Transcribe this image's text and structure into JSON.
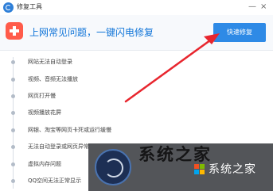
{
  "window": {
    "title": "修复工具",
    "min_glyph": "—",
    "close_glyph": "×"
  },
  "header": {
    "message": "上网常见问题，一键闪电修复",
    "fix_button_label": "快速修复"
  },
  "issues": [
    {
      "label": "网站无法自动登录"
    },
    {
      "label": "视频、音频无法播放"
    },
    {
      "label": "网页打开慢"
    },
    {
      "label": "视频播放花屏"
    },
    {
      "label": "网银、淘宝等网页卡死或运行缓慢"
    },
    {
      "label": "无法自动登录或网页异常"
    },
    {
      "label": "虚拟内存问题"
    },
    {
      "label": "QQ空间无法正常显示"
    }
  ],
  "watermark": {
    "text": "系统之家",
    "big_text": "系统之家"
  },
  "colors": {
    "accent": "#2e8ae6",
    "header_text": "#0f74d8",
    "annotation_arrow": "#e8262e"
  }
}
